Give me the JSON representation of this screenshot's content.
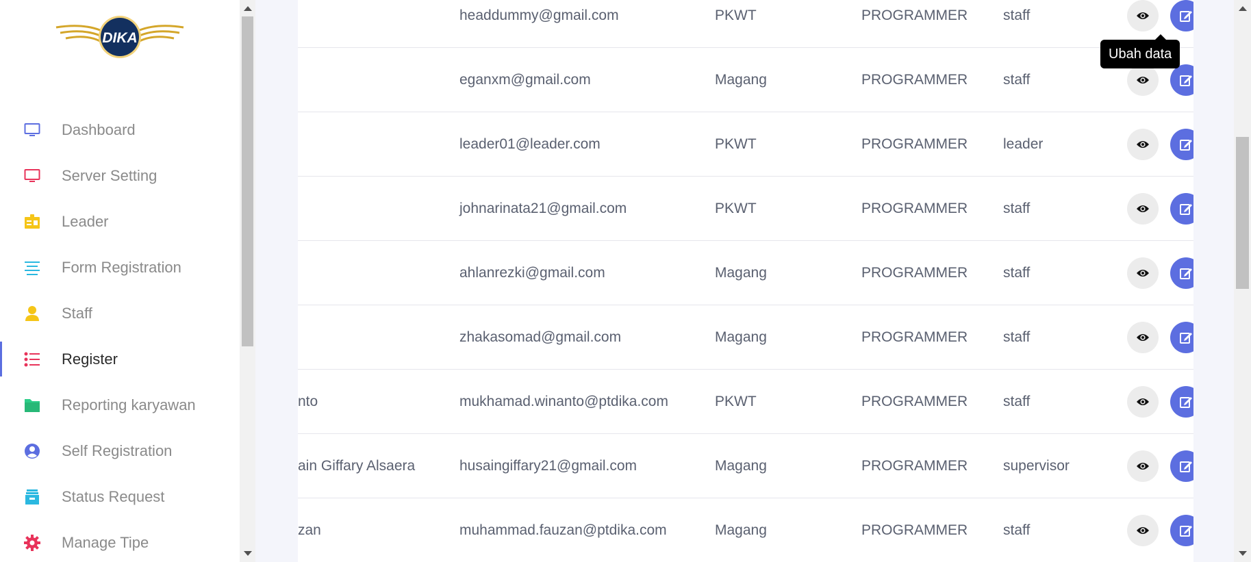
{
  "brand": {
    "logo_text": "DIKA"
  },
  "sidebar": {
    "items": [
      {
        "label": "Dashboard",
        "icon": "monitor-icon",
        "color": "#5c6ee0",
        "active": false
      },
      {
        "label": "Server Setting",
        "icon": "monitor-icon",
        "color": "#e8335a",
        "active": false
      },
      {
        "label": "Leader",
        "icon": "id-card-icon",
        "color": "#f5c518",
        "active": false
      },
      {
        "label": "Form Registration",
        "icon": "align-left-icon",
        "color": "#2bb8e0",
        "active": false
      },
      {
        "label": "Staff",
        "icon": "user-icon",
        "color": "#f5c518",
        "active": false
      },
      {
        "label": "Register",
        "icon": "list-icon",
        "color": "#e8335a",
        "active": true
      },
      {
        "label": "Reporting karyawan",
        "icon": "folder-icon",
        "color": "#2dce89",
        "active": false
      },
      {
        "label": "Self Registration",
        "icon": "user-circle-icon",
        "color": "#5c6ee0",
        "active": false
      },
      {
        "label": "Status Request",
        "icon": "archive-icon",
        "color": "#2bb8e0",
        "active": false
      },
      {
        "label": "Manage Tipe",
        "icon": "gear-icon",
        "color": "#e8335a",
        "active": false
      }
    ]
  },
  "table": {
    "rows": [
      {
        "name": "",
        "email": "headdummy@gmail.com",
        "status": "PKWT",
        "position": "PROGRAMMER",
        "role": "staff"
      },
      {
        "name": "",
        "email": "eganxm@gmail.com",
        "status": "Magang",
        "position": "PROGRAMMER",
        "role": "staff"
      },
      {
        "name": "",
        "email": "leader01@leader.com",
        "status": "PKWT",
        "position": "PROGRAMMER",
        "role": "leader"
      },
      {
        "name": "",
        "email": "johnarinata21@gmail.com",
        "status": "PKWT",
        "position": "PROGRAMMER",
        "role": "staff"
      },
      {
        "name": "",
        "email": "ahlanrezki@gmail.com",
        "status": "Magang",
        "position": "PROGRAMMER",
        "role": "staff"
      },
      {
        "name": "",
        "email": "zhakasomad@gmail.com",
        "status": "Magang",
        "position": "PROGRAMMER",
        "role": "staff"
      },
      {
        "name": "nto",
        "email": "mukhamad.winanto@ptdika.com",
        "status": "PKWT",
        "position": "PROGRAMMER",
        "role": "staff"
      },
      {
        "name": "ain Giffary Alsaera",
        "email": "husaingiffary21@gmail.com",
        "status": "Magang",
        "position": "PROGRAMMER",
        "role": "supervisor"
      },
      {
        "name": "zan",
        "email": "muhammad.fauzan@ptdika.com",
        "status": "Magang",
        "position": "PROGRAMMER",
        "role": "staff"
      }
    ],
    "view_icon": "eye-icon",
    "edit_icon": "edit-icon"
  },
  "tooltip": {
    "text": "Ubah data"
  },
  "colors": {
    "accent": "#5c6ee0",
    "view_bg": "#ececec"
  }
}
